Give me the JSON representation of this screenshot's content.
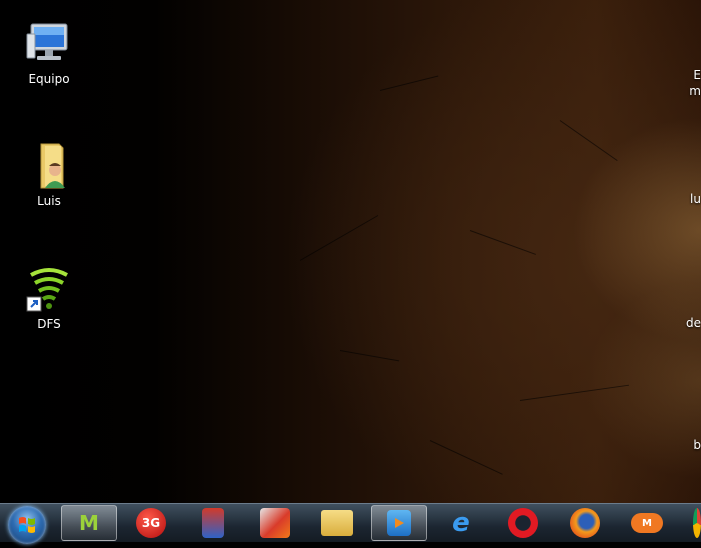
{
  "desktop": {
    "icons": [
      {
        "label": "Equipo",
        "icon": "computer-icon"
      },
      {
        "label": "Luis",
        "icon": "user-folder-icon"
      },
      {
        "label": "DFS",
        "icon": "wifi-shortcut-icon"
      }
    ],
    "right_labels": [
      "E",
      "m",
      "lu",
      "de",
      "b"
    ]
  },
  "taskbar": {
    "start": "windows-start-icon",
    "apps": [
      {
        "icon": "movistar-icon",
        "text": "M",
        "active": true
      },
      {
        "icon": "3g-icon",
        "text": "3G",
        "active": false
      },
      {
        "icon": "usb-tool-icon",
        "text": "",
        "active": false
      },
      {
        "icon": "ccleaner-icon",
        "text": "",
        "active": false
      },
      {
        "icon": "file-explorer-icon",
        "text": "",
        "active": false
      },
      {
        "icon": "media-player-icon",
        "text": "",
        "active": true
      },
      {
        "icon": "internet-explorer-icon",
        "text": "e",
        "active": false
      },
      {
        "icon": "opera-icon",
        "text": "O",
        "active": false
      },
      {
        "icon": "firefox-icon",
        "text": "",
        "active": false
      },
      {
        "icon": "mega-cloud-icon",
        "text": "M",
        "active": false
      },
      {
        "icon": "chrome-icon",
        "text": "",
        "active": false
      }
    ]
  }
}
